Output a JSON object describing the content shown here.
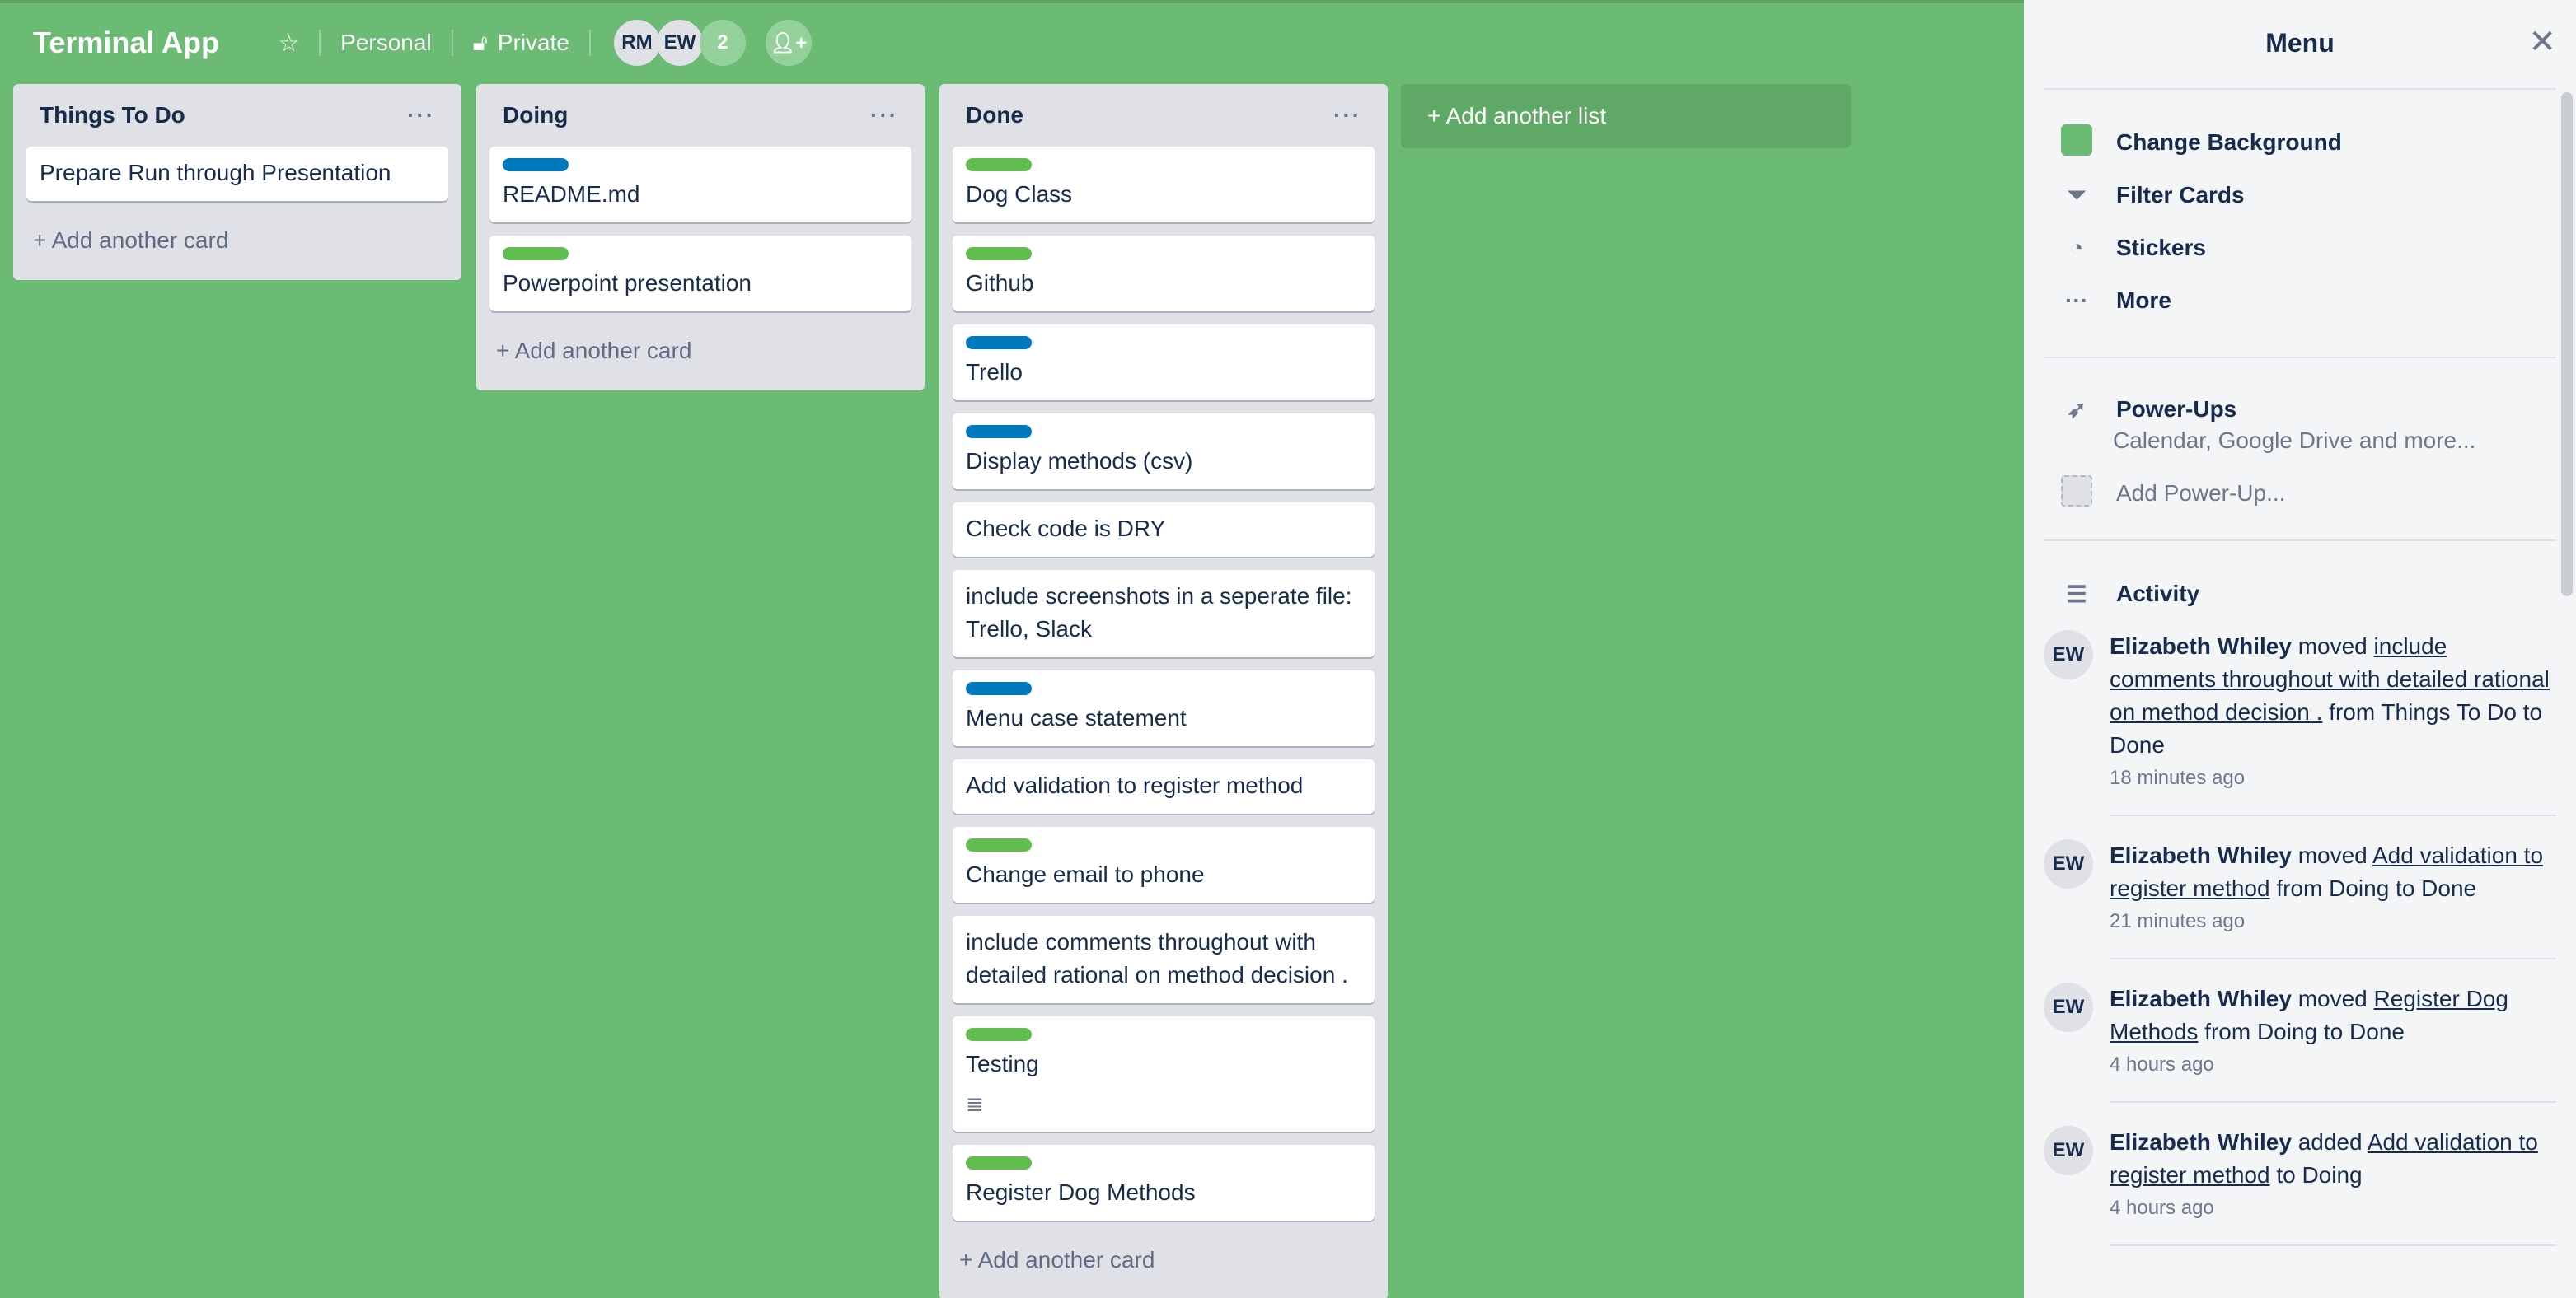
{
  "header": {
    "title": "Terminal App",
    "star_icon": "star-icon",
    "visibility_team": "Personal",
    "visibility": "Private",
    "members": [
      "RM",
      "EW"
    ],
    "member_count": "2",
    "invite_icon": "add-member-icon"
  },
  "colors": {
    "background": "#6bbb74",
    "label_green": "#61bd4f",
    "label_blue": "#0079bf"
  },
  "lists": [
    {
      "name": "Things To Do",
      "add_card": "+ Add another card",
      "cards": [
        {
          "title": "Prepare Run through Presentation"
        }
      ]
    },
    {
      "name": "Doing",
      "add_card": "+ Add another card",
      "cards": [
        {
          "title": "README.md",
          "label": "blue"
        },
        {
          "title": "Powerpoint presentation",
          "label": "green"
        }
      ]
    },
    {
      "name": "Done",
      "add_card": "+ Add another card",
      "cards": [
        {
          "title": "Dog Class",
          "label": "green"
        },
        {
          "title": "Github",
          "label": "green"
        },
        {
          "title": "Trello",
          "label": "blue"
        },
        {
          "title": "Display methods (csv)",
          "label": "blue"
        },
        {
          "title": "Check code is DRY"
        },
        {
          "title": "include screenshots in a seperate file: Trello, Slack"
        },
        {
          "title": "Menu case statement",
          "label": "blue"
        },
        {
          "title": "Add validation to register method"
        },
        {
          "title": "Change email to phone",
          "label": "green"
        },
        {
          "title": "include comments throughout with detailed rational on method decision ."
        },
        {
          "title": "Testing",
          "label": "green",
          "has_description": true
        },
        {
          "title": "Register Dog Methods",
          "label": "green"
        }
      ]
    }
  ],
  "add_list": "+ Add another list",
  "menu": {
    "title": "Menu",
    "items": [
      {
        "label": "Change Background",
        "icon": "color-swatch"
      },
      {
        "label": "Filter Cards",
        "icon": "filter-icon"
      },
      {
        "label": "Stickers",
        "icon": "sticker-icon"
      },
      {
        "label": "More",
        "icon": "more-icon"
      }
    ],
    "powerups": {
      "label": "Power-Ups",
      "sub": "Calendar, Google Drive and more...",
      "add": "Add Power-Up..."
    },
    "activity_title": "Activity",
    "activity": [
      {
        "avatar": "EW",
        "user": "Elizabeth Whiley",
        "verb": " moved ",
        "card": "include comments throughout with detailed rational on method decision .",
        "rest": " from Things To Do to Done",
        "time": "18 minutes ago"
      },
      {
        "avatar": "EW",
        "user": "Elizabeth Whiley",
        "verb": " moved ",
        "card": "Add validation to register method",
        "rest": " from Doing to Done",
        "time": "21 minutes ago"
      },
      {
        "avatar": "EW",
        "user": "Elizabeth Whiley",
        "verb": " moved ",
        "card": "Register Dog Methods",
        "rest": " from Doing to Done",
        "time": "4 hours ago"
      },
      {
        "avatar": "EW",
        "user": "Elizabeth Whiley",
        "verb": " added ",
        "card": "Add validation to register method",
        "rest": " to Doing",
        "time": "4 hours ago"
      }
    ]
  }
}
